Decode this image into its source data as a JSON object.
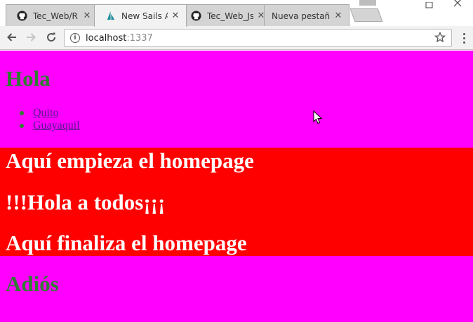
{
  "browser": {
    "tabs": [
      {
        "title": "Tec_Web/R",
        "favicon": "github-icon",
        "active": false
      },
      {
        "title": "New Sails A",
        "favicon": "sails-icon",
        "active": true
      },
      {
        "title": "Tec_Web_Js",
        "favicon": "github-icon",
        "active": false
      },
      {
        "title": "Nueva pestaña",
        "favicon": "",
        "active": false
      }
    ],
    "tab_close_glyph": "✕",
    "address": {
      "host": "localhost",
      "port": ":1337"
    }
  },
  "page": {
    "heading": "Hola",
    "cities": [
      "Quito",
      "Guayaquil"
    ],
    "red_block": {
      "line1": "Aquí empieza el homepage",
      "line2": "!!!Hola a todos¡¡¡",
      "line3": "Aquí finaliza el homepage"
    },
    "footer_heading": "Adiós"
  },
  "colors": {
    "page_bg": "#ff00ff",
    "heading_green": "#2f7d32",
    "red_block": "#ff0000",
    "link": "#551a8b"
  }
}
